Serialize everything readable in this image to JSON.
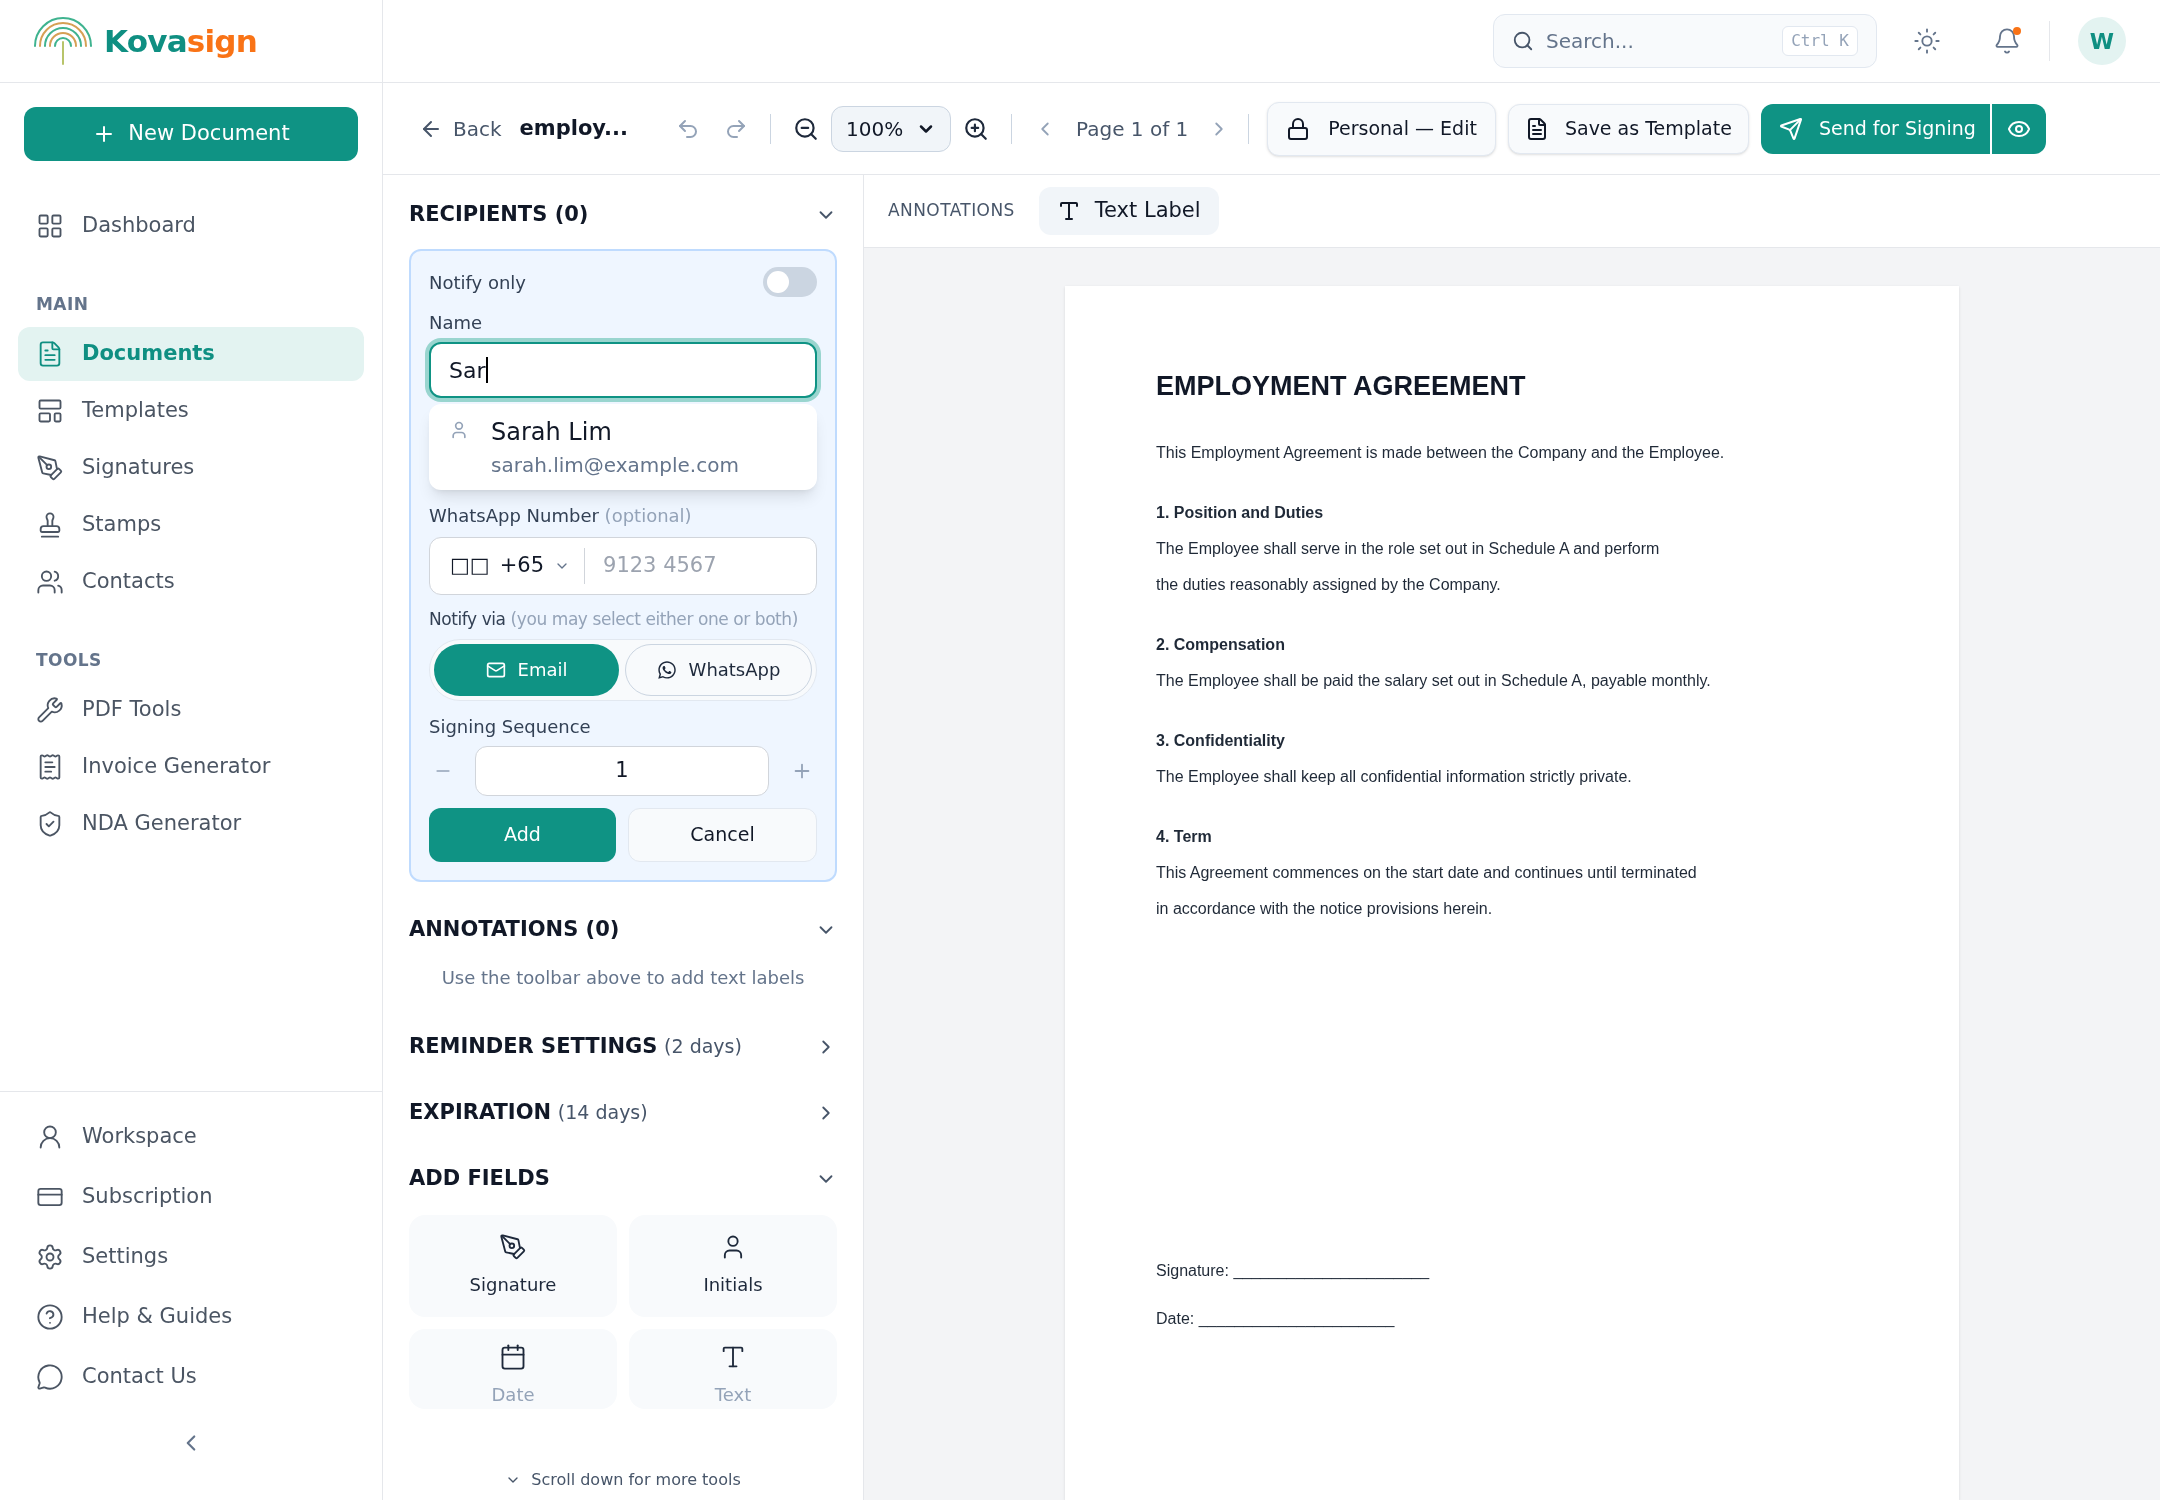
{
  "brand": {
    "name_a": "Kova",
    "name_b": "sign"
  },
  "sidebar": {
    "new_button": "New Document",
    "top_items": [
      {
        "label": "Dashboard",
        "selected": false
      }
    ],
    "sections": [
      {
        "title": "MAIN",
        "items": [
          {
            "label": "Documents",
            "selected": true
          },
          {
            "label": "Templates",
            "selected": false
          },
          {
            "label": "Signatures",
            "selected": false
          },
          {
            "label": "Stamps",
            "selected": false
          },
          {
            "label": "Contacts",
            "selected": false
          }
        ]
      },
      {
        "title": "TOOLS",
        "items": [
          {
            "label": "PDF Tools",
            "selected": false
          },
          {
            "label": "Invoice Generator",
            "selected": false
          },
          {
            "label": "NDA Generator",
            "selected": false
          }
        ]
      }
    ],
    "bottom_items": [
      {
        "label": "Workspace"
      },
      {
        "label": "Subscription"
      },
      {
        "label": "Settings"
      },
      {
        "label": "Help & Guides"
      },
      {
        "label": "Contact Us"
      }
    ]
  },
  "header": {
    "search": {
      "placeholder": "Search...",
      "shortcut": "Ctrl K"
    },
    "avatar": "W",
    "notification_dot": true
  },
  "toolbar": {
    "back": "Back",
    "doc_name": "employ...",
    "zoom": "100%",
    "page": "Page 1 of 1",
    "access": "Personal — Edit",
    "save_template": "Save as Template",
    "send": "Send for Signing"
  },
  "recipients": {
    "title": "RECIPIENTS (0)",
    "form": {
      "notify_only": {
        "label": "Notify only",
        "on": false
      },
      "name_label": "Name",
      "name_value": "Sar",
      "suggestion": {
        "name": "Sarah Lim",
        "email": "sarah.lim@example.com"
      },
      "whatsapp_label": "WhatsApp Number",
      "whatsapp_hint": "(optional)",
      "flag": "□□",
      "country_code": "+65",
      "phone_placeholder": "9123 4567",
      "notify_via_label": "Notify via",
      "notify_via_hint": "(you may select either one or both)",
      "channels": [
        {
          "label": "Email",
          "selected": true
        },
        {
          "label": "WhatsApp",
          "selected": false
        }
      ],
      "sequence_label": "Signing Sequence",
      "sequence_value": "1",
      "add": "Add",
      "cancel": "Cancel"
    }
  },
  "annotations_section": {
    "title": "ANNOTATIONS (0)",
    "hint": "Use the toolbar above to add text labels"
  },
  "reminder": {
    "title": "REMINDER SETTINGS",
    "detail": "(2 days)"
  },
  "expiration": {
    "title": "EXPIRATION",
    "detail": "(14 days)"
  },
  "add_fields": {
    "title": "ADD FIELDS",
    "fields": [
      {
        "label": "Signature"
      },
      {
        "label": "Initials"
      },
      {
        "label": "Date"
      },
      {
        "label": "Text"
      }
    ],
    "scroll_hint": "Scroll down for more tools"
  },
  "annotation_bar": {
    "label": "ANNOTATIONS",
    "tool": "Text Label"
  },
  "document": {
    "title": "EMPLOYMENT AGREEMENT",
    "intro": "This Employment Agreement is made between the Company and the Employee.",
    "sections": [
      {
        "heading": "1. Position and Duties",
        "lines": [
          "The Employee shall serve in the role set out in Schedule A and perform",
          "the duties reasonably assigned by the Company."
        ]
      },
      {
        "heading": "2. Compensation",
        "lines": [
          "The Employee shall be paid the salary set out in Schedule A, payable monthly."
        ]
      },
      {
        "heading": "3. Confidentiality",
        "lines": [
          "The Employee shall keep all confidential information strictly private."
        ]
      },
      {
        "heading": "4. Term",
        "lines": [
          "This Agreement commences on the start date and continues until terminated",
          "in accordance with the notice provisions herein."
        ]
      }
    ],
    "signature_line": "Signature: ______________________",
    "date_line": "Date: ______________________"
  }
}
